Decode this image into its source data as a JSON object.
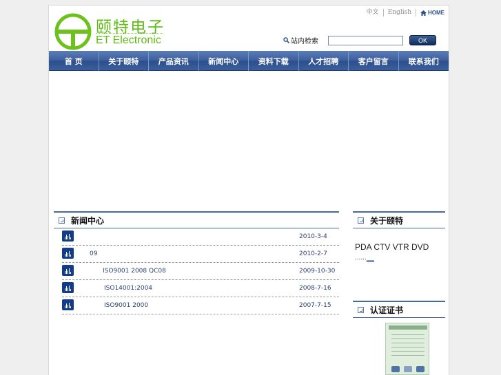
{
  "header": {
    "logo_cn": "颐特电子",
    "logo_en": "ET Electronic",
    "lang_cn": "中文",
    "lang_en": "English",
    "home": "HOME",
    "search_label": "站内检索",
    "search_value": "",
    "search_button": "OK"
  },
  "nav": {
    "items": [
      "首 页",
      "关于颐特",
      "产品资讯",
      "新闻中心",
      "资料下载",
      "人才招聘",
      "客户留言",
      "联系我们"
    ]
  },
  "news": {
    "title": "新闻中心",
    "items": [
      {
        "title": "",
        "date": "2010-3-4"
      },
      {
        "title": "09",
        "date": "2010-2-7"
      },
      {
        "title": "ISO9001 2008 QC08",
        "date": "2009-10-30"
      },
      {
        "title": "ISO14001:2004",
        "date": "2008-7-16"
      },
      {
        "title": "ISO9001 2000",
        "date": "2007-7-15"
      }
    ]
  },
  "about": {
    "title": "关于颐特",
    "text": "PDA CTV VTR DVD",
    "more_prefix": "......",
    "more_link": "__"
  },
  "cert": {
    "title": "认证证书"
  },
  "colors": {
    "brand_green": "#5dbb12",
    "nav_blue": "#3f62a0",
    "link_blue": "#2a3e70"
  }
}
